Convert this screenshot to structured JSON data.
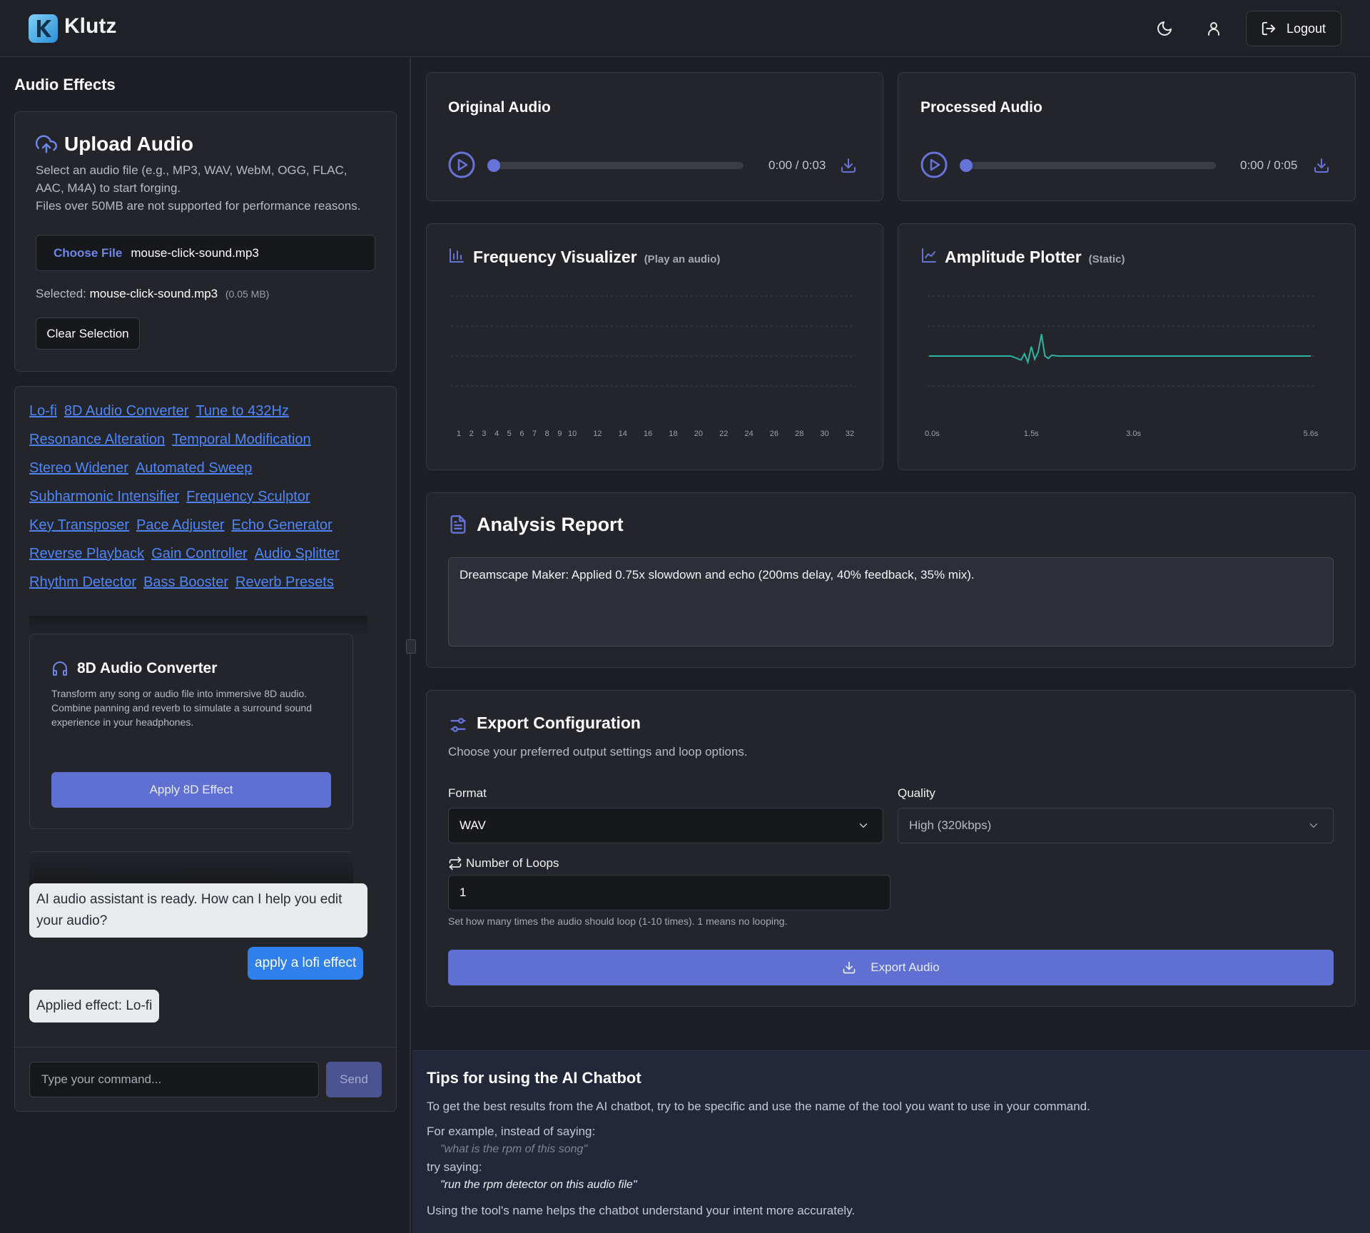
{
  "header": {
    "brand": "Klutz",
    "logout_label": "Logout"
  },
  "sidebar": {
    "title": "Audio Effects",
    "upload": {
      "title": "Upload Audio",
      "desc_line1": "Select an audio file (e.g., MP3, WAV, WebM, OGG, FLAC, AAC, M4A) to start forging.",
      "desc_line2": "Files over 50MB are not supported for performance reasons.",
      "choose_label": "Choose File",
      "file_name": "mouse-click-sound.mp3",
      "selected_label": "Selected:",
      "selected_file": "mouse-click-sound.mp3",
      "selected_size": "(0.05 MB)",
      "clear_label": "Clear Selection"
    },
    "tools": [
      [
        "Lo-fi",
        "8D Audio Converter",
        "Tune to 432Hz"
      ],
      [
        "Resonance Alteration",
        "Temporal Modification"
      ],
      [
        "Stereo Widener",
        "Automated Sweep"
      ],
      [
        "Subharmonic Intensifier",
        "Frequency Sculptor"
      ],
      [
        "Key Transposer",
        "Pace Adjuster",
        "Echo Generator"
      ],
      [
        "Reverse Playback",
        "Gain Controller",
        "Audio Splitter"
      ],
      [
        "Rhythm Detector",
        "Bass Booster",
        "Reverb Presets"
      ]
    ],
    "effect": {
      "title": "8D Audio Converter",
      "desc": "Transform any song or audio file into immersive 8D audio. Combine panning and reverb to simulate a surround sound experience in your headphones.",
      "button": "Apply 8D Effect"
    },
    "chat": {
      "messages": [
        {
          "role": "bot",
          "text": "AI audio assistant is ready. How can I help you edit your audio?"
        },
        {
          "role": "user",
          "text": "apply a lofi effect"
        },
        {
          "role": "bot",
          "text": "Applied effect: Lo-fi"
        }
      ],
      "input_placeholder": "Type your command...",
      "send_label": "Send"
    }
  },
  "players": {
    "original": {
      "title": "Original Audio",
      "time": "0:00 / 0:03",
      "progress": 0.0
    },
    "processed": {
      "title": "Processed Audio",
      "time": "0:00 / 0:05",
      "progress": 0.0
    }
  },
  "frequency": {
    "title": "Frequency Visualizer",
    "subtitle": "(Play an audio)",
    "ticks": [
      "1",
      "2",
      "3",
      "4",
      "5",
      "6",
      "7",
      "8",
      "9",
      "10",
      "12",
      "14",
      "16",
      "18",
      "20",
      "22",
      "24",
      "26",
      "28",
      "30",
      "32"
    ]
  },
  "amplitude": {
    "title": "Amplitude Plotter",
    "subtitle": "(Static)",
    "ticks": [
      "0.0s",
      "1.5s",
      "3.0s",
      "5.6s"
    ]
  },
  "chart_data": [
    {
      "type": "bar",
      "categories": [
        "1",
        "2",
        "3",
        "4",
        "5",
        "6",
        "7",
        "8",
        "9",
        "10",
        "12",
        "14",
        "16",
        "18",
        "20",
        "22",
        "24",
        "26",
        "28",
        "30",
        "32"
      ],
      "values": [],
      "grid": true
    },
    {
      "type": "line",
      "x": [
        0.0,
        1.2,
        1.35,
        1.4,
        1.45,
        1.5,
        1.55,
        1.6,
        1.65,
        1.7,
        1.75,
        1.8,
        1.9,
        2.1,
        5.6
      ],
      "y": [
        0.0,
        0.0,
        -0.05,
        0.03,
        -0.08,
        0.12,
        -0.04,
        0.05,
        0.28,
        0.0,
        -0.03,
        0.01,
        0.0,
        0.0,
        0.0
      ],
      "ylim": [
        -1,
        1
      ],
      "grid": true,
      "color": "#2bb5a0"
    }
  ],
  "report": {
    "title": "Analysis Report",
    "text": "Dreamscape Maker: Applied 0.75x slowdown and echo (200ms delay, 40% feedback, 35% mix)."
  },
  "export": {
    "title": "Export Configuration",
    "subtitle": "Choose your preferred output settings and loop options.",
    "format_label": "Format",
    "format_value": "WAV",
    "quality_label": "Quality",
    "quality_value": "High (320kbps)",
    "loops_label": "Number of Loops",
    "loops_value": "1",
    "loops_help": "Set how many times the audio should loop (1-10 times). 1 means no looping.",
    "button": "Export Audio"
  },
  "tips": {
    "title": "Tips for using the AI Chatbot",
    "intro": "To get the best results from the AI chatbot, try to be specific and use the name of the tool you want to use in your command.",
    "instead": "For example, instead of saying:",
    "bad_example": "\"what is the rpm of this song\"",
    "try": "try saying:",
    "good_example": "\"run the rpm detector on this audio file\"",
    "outro": "Using the tool's name helps the chatbot understand your intent more accurately."
  },
  "colors": {
    "accent": "#5f6fd2",
    "user_bubble": "#2f80ed",
    "link": "#4f86f7",
    "amplitude_line": "#2bb5a0"
  }
}
